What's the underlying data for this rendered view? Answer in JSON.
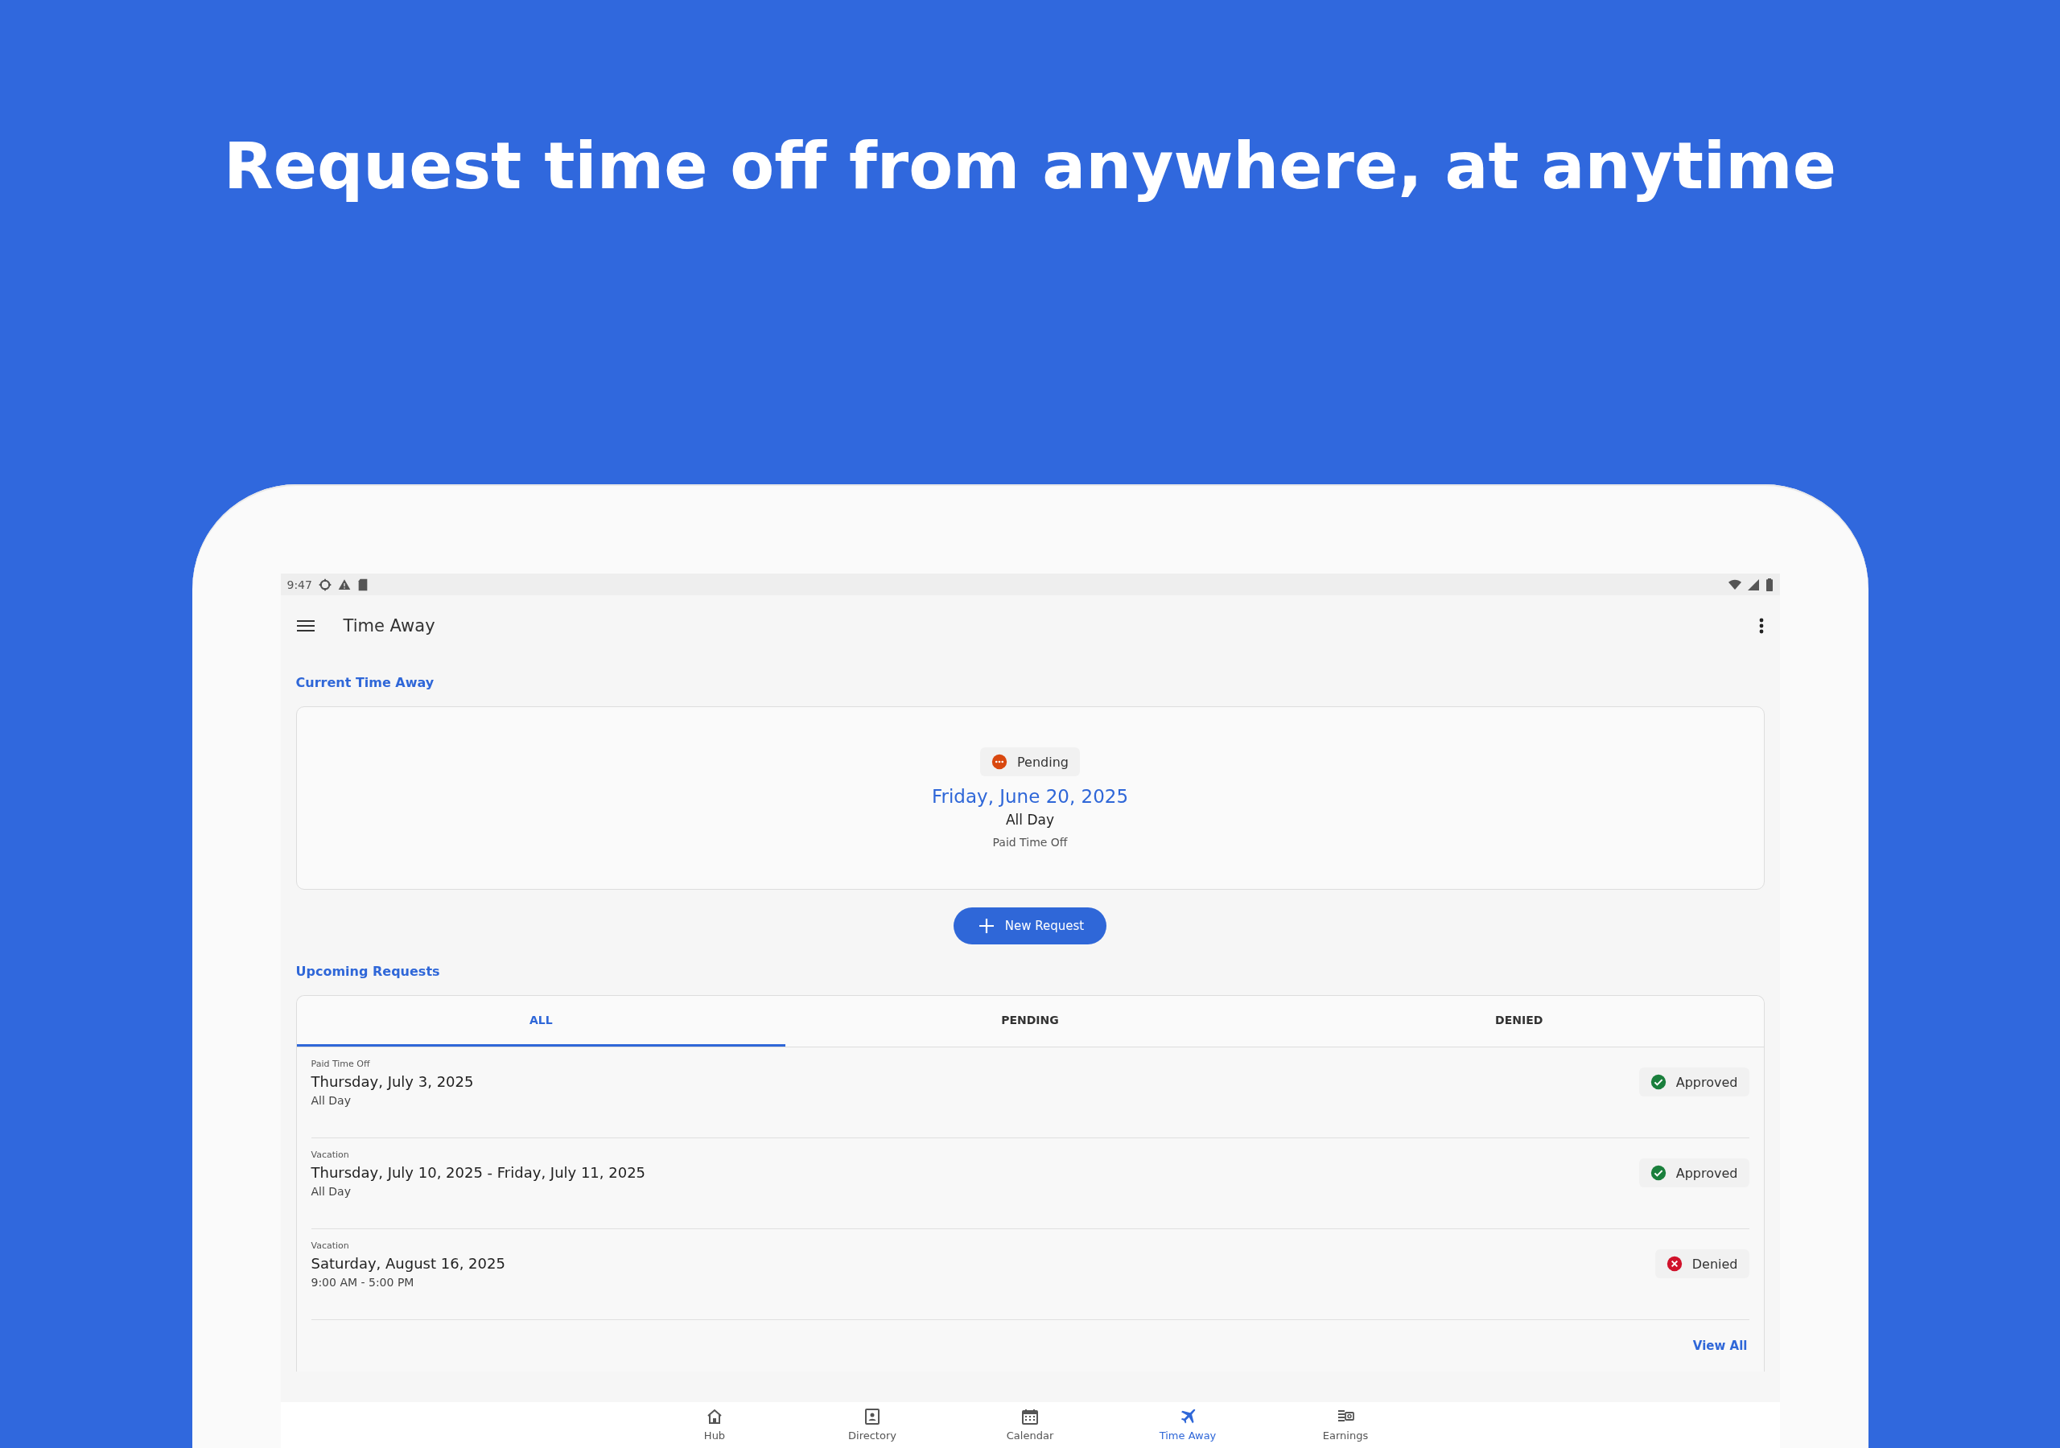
{
  "headline": "Request time off from anywhere, at anytime",
  "status_bar": {
    "time": "9:47"
  },
  "app_bar": {
    "title": "Time Away"
  },
  "current_section": {
    "title": "Current Time Away",
    "status": {
      "label": "Pending",
      "kind": "pending"
    },
    "date": "Friday, June 20, 2025",
    "duration": "All Day",
    "type": "Paid Time Off"
  },
  "new_request_button": {
    "label": "New Request"
  },
  "upcoming_section": {
    "title": "Upcoming Requests",
    "tabs": [
      {
        "label": "ALL",
        "selected": true
      },
      {
        "label": "PENDING",
        "selected": false
      },
      {
        "label": "DENIED",
        "selected": false
      }
    ],
    "requests": [
      {
        "type": "Paid Time Off",
        "dates": "Thursday, July 3, 2025",
        "time": "All Day",
        "status": {
          "label": "Approved",
          "kind": "approved"
        }
      },
      {
        "type": "Vacation",
        "dates": "Thursday, July 10, 2025 - Friday, July 11, 2025",
        "time": "All Day",
        "status": {
          "label": "Approved",
          "kind": "approved"
        }
      },
      {
        "type": "Vacation",
        "dates": "Saturday, August 16, 2025",
        "time": "9:00 AM - 5:00 PM",
        "status": {
          "label": "Denied",
          "kind": "denied"
        }
      }
    ],
    "view_all": "View All"
  },
  "bottom_nav": [
    {
      "label": "Hub",
      "selected": false
    },
    {
      "label": "Directory",
      "selected": false
    },
    {
      "label": "Calendar",
      "selected": false
    },
    {
      "label": "Time Away",
      "selected": true
    },
    {
      "label": "Earnings",
      "selected": false
    }
  ]
}
